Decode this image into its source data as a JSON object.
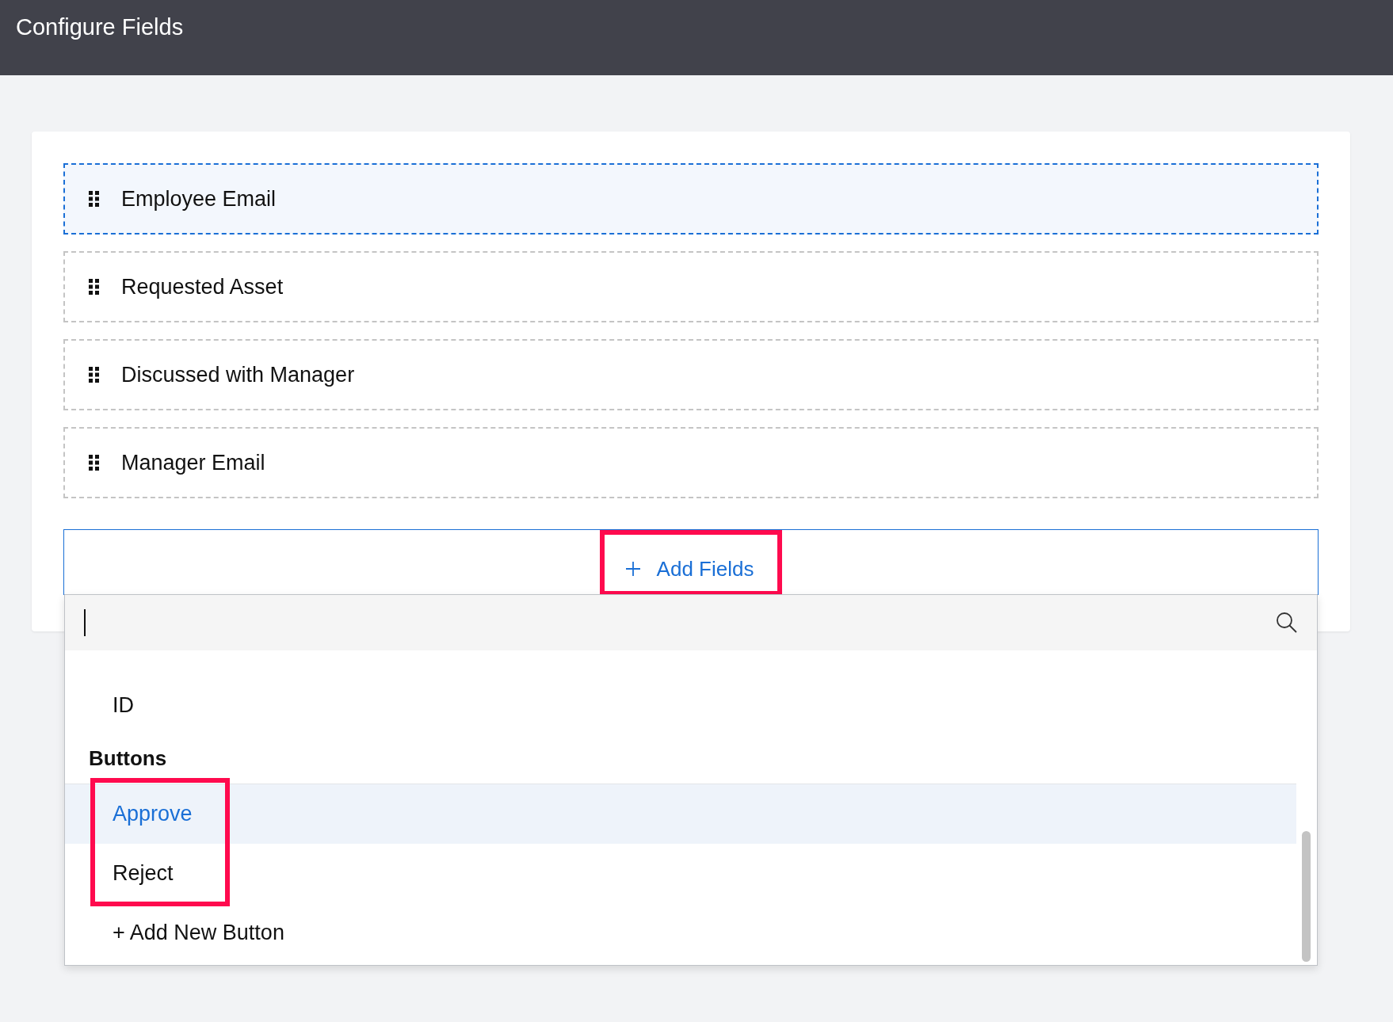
{
  "header": {
    "title": "Configure Fields"
  },
  "fields": [
    {
      "label": "Employee Email",
      "selected": true
    },
    {
      "label": "Requested Asset",
      "selected": false
    },
    {
      "label": "Discussed with Manager",
      "selected": false
    },
    {
      "label": "Manager Email",
      "selected": false
    }
  ],
  "add_fields": {
    "label": "Add Fields",
    "highlighted": true
  },
  "dropdown": {
    "items": [
      {
        "kind": "option",
        "label": "ID",
        "selected": false,
        "highlighted": false
      },
      {
        "kind": "group",
        "label": "Buttons"
      },
      {
        "kind": "option",
        "label": "Approve",
        "selected": true,
        "highlighted": true
      },
      {
        "kind": "option",
        "label": "Reject",
        "selected": false,
        "highlighted": true
      },
      {
        "kind": "action",
        "label": "+ Add New Button"
      }
    ]
  }
}
